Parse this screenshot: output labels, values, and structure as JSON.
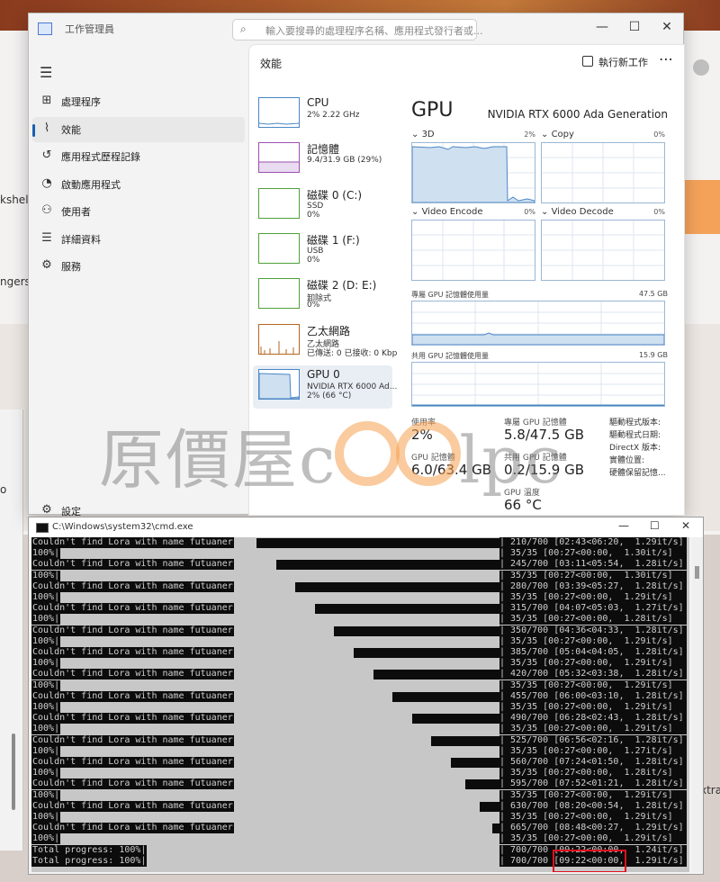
{
  "task_manager": {
    "title": "工作管理員",
    "search_placeholder": "輸入要搜尋的處理程序名稱、應用程式發行者或...",
    "nav": [
      {
        "label": "處理程序",
        "icon": "processes-grid-icon"
      },
      {
        "label": "效能",
        "icon": "performance-chart-icon",
        "selected": true
      },
      {
        "label": "應用程式歷程記錄",
        "icon": "history-icon"
      },
      {
        "label": "啟動應用程式",
        "icon": "startup-gauge-icon"
      },
      {
        "label": "使用者",
        "icon": "users-icon"
      },
      {
        "label": "詳細資料",
        "icon": "details-list-icon"
      },
      {
        "label": "服務",
        "icon": "services-puzzle-icon"
      }
    ],
    "settings_label": "設定",
    "page_title": "效能",
    "new_task_label": "執行新工作",
    "resources": [
      {
        "name": "CPU",
        "sub": [
          "2% 2.22 GHz"
        ]
      },
      {
        "name": "記憶體",
        "sub": [
          "9.4/31.9 GB (29%)"
        ]
      },
      {
        "name": "磁碟 0 (C:)",
        "sub": [
          "SSD",
          "0%"
        ]
      },
      {
        "name": "磁碟 1 (F:)",
        "sub": [
          "USB",
          "0%"
        ]
      },
      {
        "name": "磁碟 2 (D: E:)",
        "sub": [
          "卸除式",
          "0%"
        ]
      },
      {
        "name": "乙太網路",
        "sub": [
          "乙太網路",
          "已傳送: 0 已接收: 0 Kbp"
        ]
      },
      {
        "name": "GPU 0",
        "sub": [
          "NVIDIA RTX 6000 Ad...",
          "2% (66 °C)"
        ],
        "selected": true
      }
    ],
    "gpu": {
      "title": "GPU",
      "model": "NVIDIA RTX 6000 Ada Generation",
      "engines": [
        {
          "name": "3D",
          "pct": "2%"
        },
        {
          "name": "Copy",
          "pct": "0%"
        },
        {
          "name": "Video Encode",
          "pct": "0%"
        },
        {
          "name": "Video Decode",
          "pct": "0%"
        }
      ],
      "dedicated_label": "專屬 GPU 記憶體使用量",
      "dedicated_max": "47.5 GB",
      "shared_label": "共用 GPU 記憶體使用量",
      "shared_max": "15.9 GB",
      "stats": {
        "util_label": "使用率",
        "util_value": "2%",
        "ded_label": "專屬 GPU 記憶體",
        "ded_value": "5.8/47.5 GB",
        "gpumem_label": "GPU 記憶體",
        "gpumem_value": "6.0/63.4 GB",
        "shared_label": "共用 GPU 記憶體",
        "shared_value": "0.2/15.9 GB",
        "temp_label": "GPU 溫度",
        "temp_value": "66 °C"
      },
      "driver_labels": [
        "驅動程式版本:",
        "驅動程式日期:",
        "DirectX 版本:",
        "實體位置:",
        "硬體保留記憶..."
      ]
    }
  },
  "cmd": {
    "title": "C:\\Windows\\system32\\cmd.exe",
    "lines": [
      {
        "left": "Couldn't find Lora with name futuaner",
        "fill": 0.0,
        "right": "| 210/700 [02:43<06:20,  1.29it/s]"
      },
      {
        "left": "100%|",
        "fill": 1.0,
        "right": "| 35/35 [00:27<00:00,  1.30it/s]"
      },
      {
        "left": "Couldn't find Lora with name futuaner",
        "fill": 0.08,
        "right": "| 245/700 [03:11<05:54,  1.28it/s]"
      },
      {
        "left": "100%|",
        "fill": 1.0,
        "right": "| 35/35 [00:27<00:00,  1.30it/s]"
      },
      {
        "left": "Couldn't find Lora with name futuaner",
        "fill": 0.16,
        "right": "| 280/700 [03:39<05:27,  1.28it/s]"
      },
      {
        "left": "100%|",
        "fill": 1.0,
        "right": "| 35/35 [00:27<00:00,  1.29it/s]"
      },
      {
        "left": "Couldn't find Lora with name futuaner",
        "fill": 0.24,
        "right": "| 315/700 [04:07<05:03,  1.27it/s]"
      },
      {
        "left": "100%|",
        "fill": 1.0,
        "right": "| 35/35 [00:27<00:00,  1.28it/s]"
      },
      {
        "left": "Couldn't find Lora with name futuaner",
        "fill": 0.32,
        "right": "| 350/700 [04:36<04:33,  1.28it/s]"
      },
      {
        "left": "100%|",
        "fill": 1.0,
        "right": "| 35/35 [00:27<00:00,  1.29it/s]"
      },
      {
        "left": "Couldn't find Lora with name futuaner",
        "fill": 0.4,
        "right": "| 385/700 [05:04<04:05,  1.28it/s]"
      },
      {
        "left": "100%|",
        "fill": 1.0,
        "right": "| 35/35 [00:27<00:00,  1.29it/s]"
      },
      {
        "left": "Couldn't find Lora with name futuaner",
        "fill": 0.48,
        "right": "| 420/700 [05:32<03:38,  1.28it/s]"
      },
      {
        "left": "100%|",
        "fill": 1.0,
        "right": "| 35/35 [00:27<00:00,  1.29it/s]"
      },
      {
        "left": "Couldn't find Lora with name futuaner",
        "fill": 0.56,
        "right": "| 455/700 [06:00<03:10,  1.28it/s]"
      },
      {
        "left": "100%|",
        "fill": 1.0,
        "right": "| 35/35 [00:27<00:00,  1.29it/s]"
      },
      {
        "left": "Couldn't find Lora with name futuaner",
        "fill": 0.64,
        "right": "| 490/700 [06:28<02:43,  1.28it/s]"
      },
      {
        "left": "100%|",
        "fill": 1.0,
        "right": "| 35/35 [00:27<00:00,  1.29it/s]"
      },
      {
        "left": "Couldn't find Lora with name futuaner",
        "fill": 0.72,
        "right": "| 525/700 [06:56<02:16,  1.28it/s]"
      },
      {
        "left": "100%|",
        "fill": 1.0,
        "right": "| 35/35 [00:27<00:00,  1.27it/s]"
      },
      {
        "left": "Couldn't find Lora with name futuaner",
        "fill": 0.8,
        "right": "| 560/700 [07:24<01:50,  1.28it/s]"
      },
      {
        "left": "100%|",
        "fill": 1.0,
        "right": "| 35/35 [00:27<00:00,  1.28it/s]"
      },
      {
        "left": "Couldn't find Lora with name futuaner",
        "fill": 0.86,
        "right": "| 595/700 [07:52<01:21,  1.28it/s]"
      },
      {
        "left": "100%|",
        "fill": 1.0,
        "right": "| 35/35 [00:27<00:00,  1.29it/s]"
      },
      {
        "left": "Couldn't find Lora with name futuaner",
        "fill": 0.92,
        "right": "| 630/700 [08:20<00:54,  1.28it/s]"
      },
      {
        "left": "100%|",
        "fill": 1.0,
        "right": "| 35/35 [00:27<00:00,  1.29it/s]"
      },
      {
        "left": "Couldn't find Lora with name futuaner",
        "fill": 0.97,
        "right": "| 665/700 [08:48<00:27,  1.29it/s]"
      },
      {
        "left": "100%|",
        "fill": 1.0,
        "right": "| 35/35 [00:27<00:00,  1.29it/s]"
      },
      {
        "left": "Total progress: 100%|",
        "fill": 1.0,
        "right": "| 700/700 [09:22<00:00,  1.24it/s]"
      },
      {
        "left": "Total progress: 100%|",
        "fill": 1.0,
        "right": "| 700/700 [09:22<00:00,  1.29it/s]"
      }
    ]
  },
  "watermark": "原價屋coolpc",
  "background": {
    "frag1": "kshelv",
    "frag2": "ngers,s",
    "frag3": "xtra",
    "frag4": "o"
  }
}
